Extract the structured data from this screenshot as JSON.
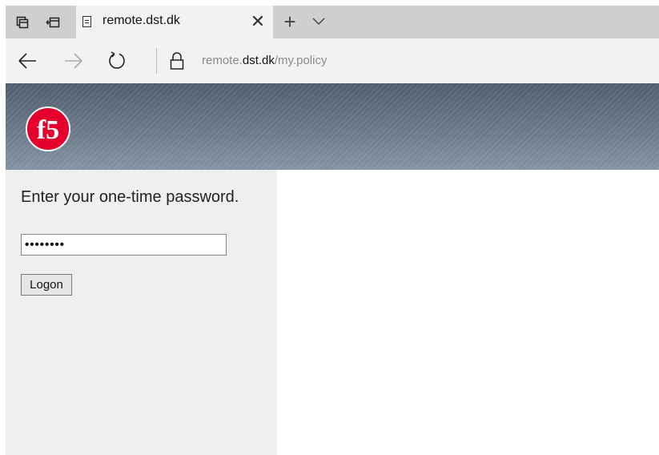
{
  "browser": {
    "tab": {
      "title": "remote.dst.dk",
      "close_symbol": "✕"
    },
    "newtab_symbol": "+",
    "url": {
      "prefix": "remote.",
      "host": "dst.dk",
      "path": "/my.policy"
    },
    "icons": [
      "tab-previews-icon",
      "set-tabs-aside-icon",
      "page-icon",
      "close-icon",
      "new-tab-icon",
      "chevron-down-icon",
      "back-arrow-icon",
      "forward-arrow-icon",
      "refresh-icon",
      "lock-icon"
    ]
  },
  "header": {
    "logo_text": "f5",
    "brand_color": "#e4002b"
  },
  "login": {
    "prompt": "Enter your one-time password.",
    "password_value": "••••••••",
    "logon_label": "Logon"
  }
}
